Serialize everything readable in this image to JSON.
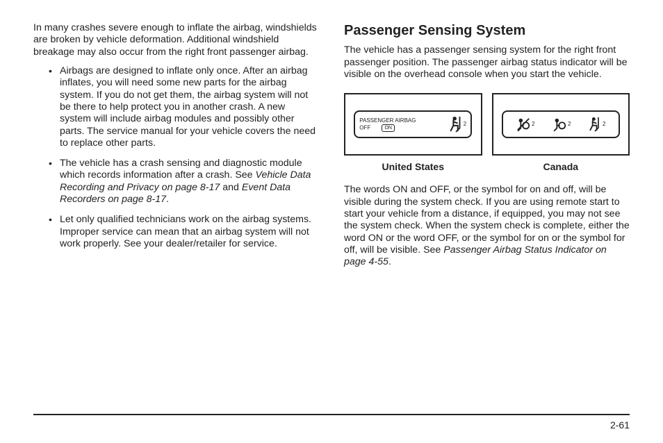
{
  "left": {
    "intro": "In many crashes severe enough to inflate the airbag, windshields are broken by vehicle deformation. Additional windshield breakage may also occur from the right front passenger airbag.",
    "bullets": [
      {
        "text": "Airbags are designed to inflate only once. After an airbag inflates, you will need some new parts for the airbag system. If you do not get them, the airbag system will not be there to help protect you in another crash. A new system will include airbag modules and possibly other parts. The service manual for your vehicle covers the need to replace other parts."
      },
      {
        "prefix": "The vehicle has a crash sensing and diagnostic module which records information after a crash. See ",
        "ref1": "Vehicle Data Recording and Privacy on page 8-17",
        "mid": " and ",
        "ref2": "Event Data Recorders on page 8-17",
        "suffix": "."
      },
      {
        "text": "Let only qualified technicians work on the airbag systems. Improper service can mean that an airbag system will not work properly. See your dealer/retailer for service."
      }
    ]
  },
  "right": {
    "heading": "Passenger Sensing System",
    "p1": "The vehicle has a passenger sensing system for the right front passenger position. The passenger airbag status indicator will be visible on the overhead console when you start the vehicle.",
    "diagram": {
      "us": {
        "line1": "PASSENGER AIRBAG",
        "line2_off": "OFF",
        "line2_on": "ON",
        "seat_sub": "2"
      },
      "ca": {
        "sub": "2"
      },
      "caption_us": "United States",
      "caption_ca": "Canada"
    },
    "p2_prefix": "The words ON and OFF, or the symbol for on and off, will be visible during the system check. If you are using remote start to start your vehicle from a distance, if equipped, you may not see the system check. When the system check is complete, either the word ON or the word OFF, or the symbol for on or the symbol for off, will be visible. See ",
    "p2_ref": "Passenger Airbag Status Indicator on page 4-55",
    "p2_suffix": "."
  },
  "page_number": "2-61"
}
